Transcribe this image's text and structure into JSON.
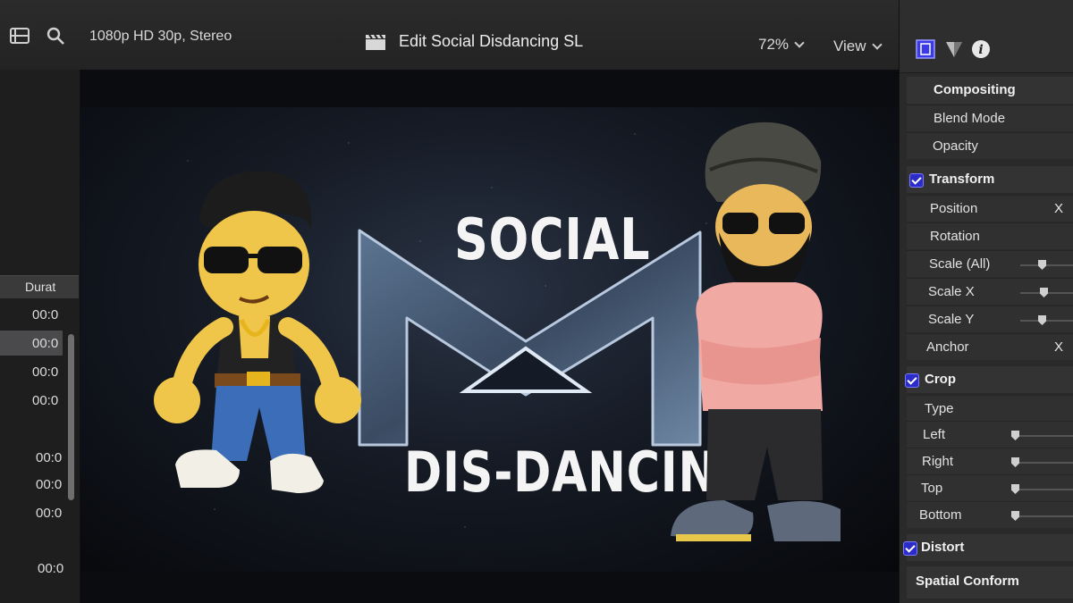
{
  "toolbar": {
    "format": "1080p HD 30p, Stereo",
    "title": "Edit Social Disdancing SL",
    "zoom": "72%",
    "view": "View"
  },
  "browser": {
    "column_header": "Durat",
    "durations": [
      "00:0",
      "00:0",
      "00:0",
      "00:0",
      "00:0",
      "00:0",
      "00:0",
      "00:0"
    ]
  },
  "viewer": {
    "logo_top": "SOCIAL",
    "logo_bottom": "DIS-DANCING"
  },
  "inspector": {
    "sections": {
      "compositing": "Compositing",
      "blend_mode": "Blend Mode",
      "opacity": "Opacity",
      "transform": "Transform",
      "position": "Position",
      "position_x": "X",
      "rotation": "Rotation",
      "scale_all": "Scale (All)",
      "scale_x": "Scale X",
      "scale_y": "Scale Y",
      "anchor": "Anchor",
      "anchor_x": "X",
      "crop": "Crop",
      "type": "Type",
      "left": "Left",
      "right": "Right",
      "top": "Top",
      "bottom": "Bottom",
      "distort": "Distort",
      "spatial_conform": "Spatial Conform"
    }
  },
  "colors": {
    "accent": "#2c2cc8",
    "panel": "#2a2a2b"
  },
  "icons": [
    "filmstrip-icon",
    "search-icon",
    "clapperboard-icon",
    "video-inspector-icon",
    "color-inspector-icon",
    "info-icon"
  ]
}
